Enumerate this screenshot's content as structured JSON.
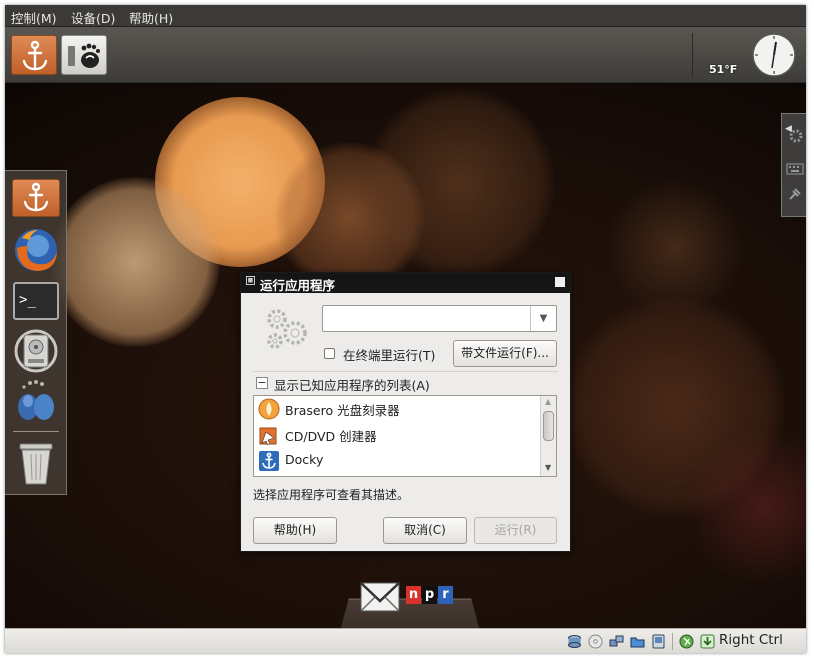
{
  "menubar": {
    "items": [
      "控制(M)",
      "设备(D)",
      "帮助(H)"
    ]
  },
  "panel": {
    "temperature": "51°F",
    "launchers": [
      "docky-anchor-icon",
      "gnome-foot-icon"
    ]
  },
  "dock": {
    "items": [
      "docky-anchor-icon",
      "firefox-icon",
      "terminal-icon",
      "disk-utility-icon",
      "pidgin-icon",
      "trash-icon"
    ]
  },
  "dialog": {
    "title": "运行应用程序",
    "command_value": "",
    "terminal_checkbox_label": "在终端里运行(T)",
    "terminal_checked": false,
    "run_with_file_button": "带文件运行(F)...",
    "expander_label": "显示已知应用程序的列表(A)",
    "expander_symbol": "−",
    "apps": [
      {
        "name": "Brasero 光盘刻录器",
        "icon": "brasero-icon"
      },
      {
        "name": "CD/DVD 创建器",
        "icon": "cd-dvd-creator-icon"
      },
      {
        "name": "Docky",
        "icon": "docky-icon"
      }
    ],
    "description": "选择应用程序可查看其描述。",
    "help_button": "帮助(H)",
    "cancel_button": "取消(C)",
    "run_button": "运行(R)",
    "run_enabled": false
  },
  "bottom_dock": {
    "items": [
      "mail-icon",
      "npr-icon"
    ],
    "npr_letters": [
      "n",
      "p",
      "r"
    ]
  },
  "statusbar": {
    "icons": [
      "hard-disk-icon",
      "cd-icon",
      "network-icon",
      "shared-folder-icon",
      "display-icon",
      "mouse-integration-icon",
      "arrow-down-icon"
    ],
    "host_key": "Right Ctrl"
  },
  "colors": {
    "accent_orange": "#d96e30",
    "title_bar": "#151515",
    "dialog_bg": "#edeceb"
  }
}
